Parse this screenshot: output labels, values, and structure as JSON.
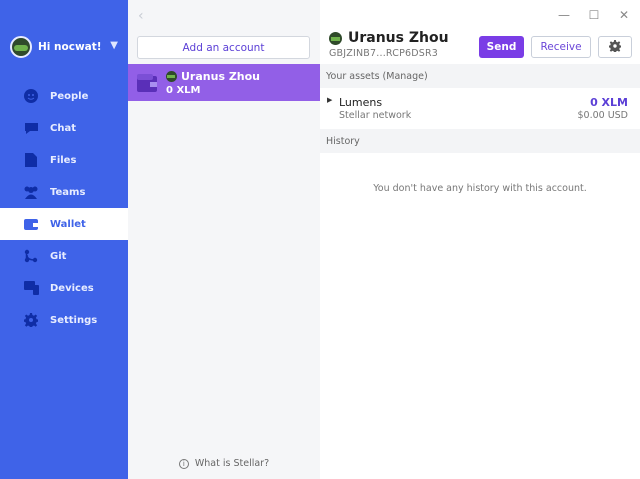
{
  "sidebar": {
    "user_label": "Hi nocwat!",
    "items": [
      {
        "label": "People",
        "icon": "people-icon"
      },
      {
        "label": "Chat",
        "icon": "chat-icon"
      },
      {
        "label": "Files",
        "icon": "files-icon"
      },
      {
        "label": "Teams",
        "icon": "teams-icon"
      },
      {
        "label": "Wallet",
        "icon": "wallet-icon",
        "active": true
      },
      {
        "label": "Git",
        "icon": "git-icon"
      },
      {
        "label": "Devices",
        "icon": "devices-icon"
      },
      {
        "label": "Settings",
        "icon": "gear-icon"
      }
    ]
  },
  "accounts": {
    "add_label": "Add an account",
    "selected": {
      "name": "Uranus Zhou",
      "balance": "0 XLM"
    },
    "help_label": "What is Stellar?"
  },
  "main": {
    "account_name": "Uranus Zhou",
    "address": "GBJZINB7...RCP6DSR3",
    "send_label": "Send",
    "receive_label": "Receive",
    "assets_header": "Your assets (Manage)",
    "asset": {
      "name": "Lumens",
      "network": "Stellar network",
      "balance": "0 XLM",
      "usd": "$0.00 USD"
    },
    "history_header": "History",
    "history_empty": "You don't have any history with this account."
  },
  "colors": {
    "sidebar": "#3f63e8",
    "accent_purple": "#7a3de6",
    "selected_row": "#925fe7"
  }
}
